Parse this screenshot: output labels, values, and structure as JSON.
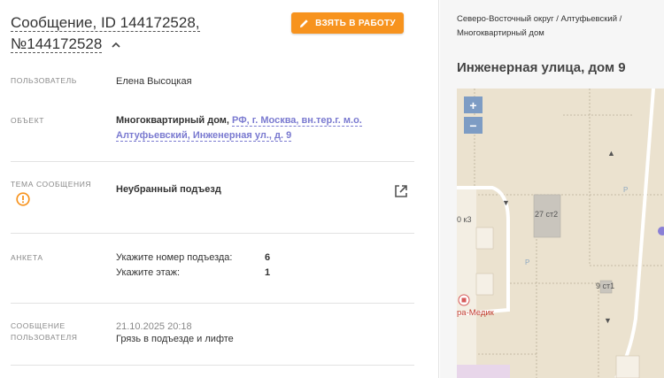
{
  "header": {
    "title_line1": "Сообщение, ID 144172528,",
    "title_line2": "№144172528",
    "take_button": "ВЗЯТЬ В РАБОТУ"
  },
  "fields": {
    "user_label": "ПОЛЬЗОВАТЕЛЬ",
    "user_value": "Елена Высоцкая",
    "object_label": "ОБЪЕКТ",
    "object_type": "Многоквартирный дом,",
    "object_link_line1": "РФ, г. Москва, вн.тер.г. м.о.",
    "object_link_line2": "Алтуфьевский, Инженерная ул., д. 9",
    "topic_label": "ТЕМА СООБЩЕНИЯ",
    "topic_value": "Неубранный подъезд",
    "survey_label": "АНКЕТА",
    "survey": [
      {
        "q": "Укажите номер подъезда:",
        "a": "6"
      },
      {
        "q": "Укажите этаж:",
        "a": "1"
      }
    ],
    "message_label_line1": "СООБЩЕНИЕ",
    "message_label_line2": "ПОЛЬЗОВАТЕЛЯ",
    "message_date": "21.10.2025 20:18",
    "message_text": "Грязь в подъезде и лифте"
  },
  "side": {
    "crumbs_line1": "Северо-Восточный округ / Алтуфьевский /",
    "crumbs_line2": "Многоквартирный дом",
    "address": "Инженерная улица, дом 9",
    "map": {
      "zoom_in": "+",
      "zoom_out": "−",
      "label_27": "27 ст2",
      "label_9": "9 ст1",
      "label_0k3": "0 к3",
      "label_medik": "ра-Медик",
      "parking": "P"
    }
  },
  "colors": {
    "accent": "#f7931e",
    "link": "#7a7ad0",
    "warning": "#f7931e"
  }
}
